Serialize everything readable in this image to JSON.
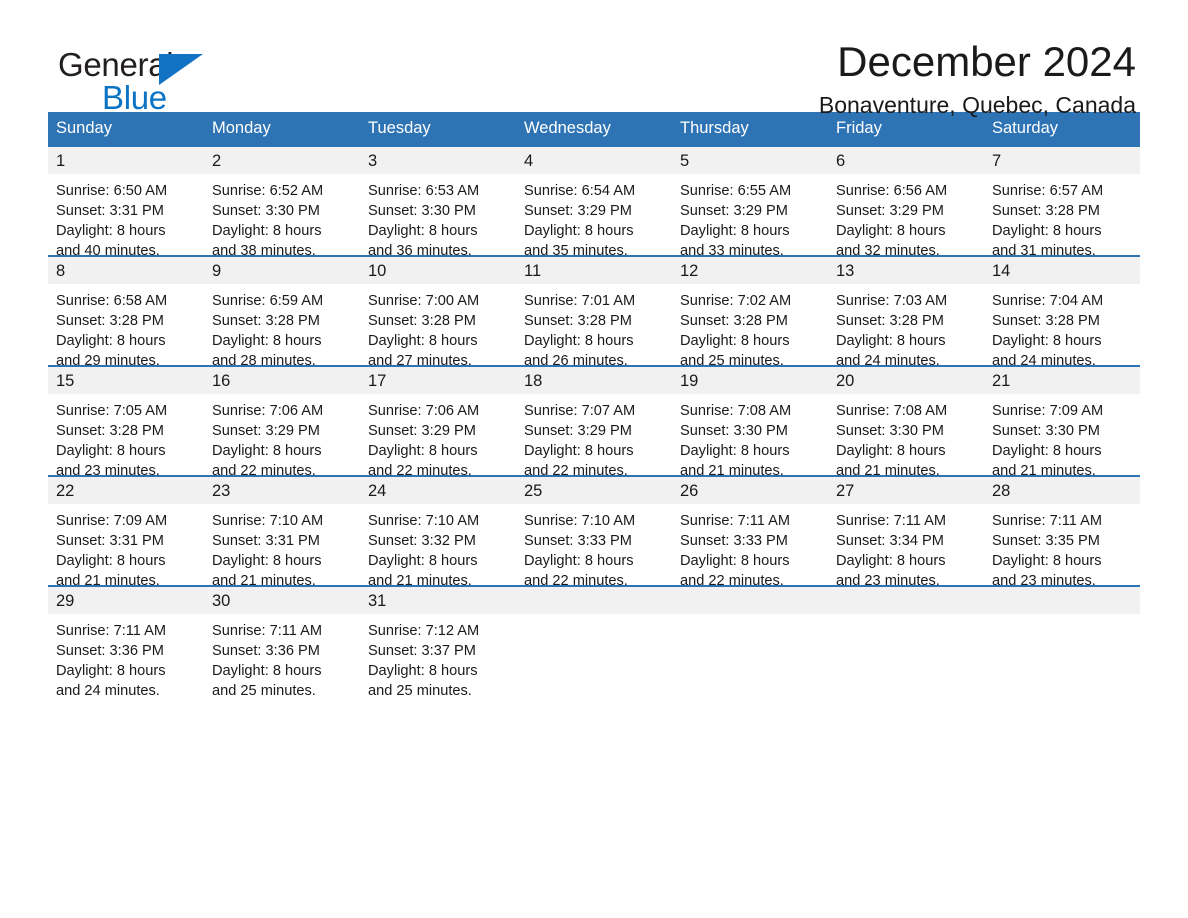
{
  "brand": {
    "name_part1": "General",
    "name_part2": "Blue",
    "accent_color": "#0b74c4",
    "header_color": "#2e74b5"
  },
  "header": {
    "month_title": "December 2024",
    "location": "Bonaventure, Quebec, Canada"
  },
  "weekday_headers": [
    "Sunday",
    "Monday",
    "Tuesday",
    "Wednesday",
    "Thursday",
    "Friday",
    "Saturday"
  ],
  "labels": {
    "sunrise_prefix": "Sunrise:",
    "sunset_prefix": "Sunset:",
    "daylight_prefix": "Daylight:"
  },
  "weeks": [
    [
      {
        "day": "1",
        "sunrise": "Sunrise: 6:50 AM",
        "sunset": "Sunset: 3:31 PM",
        "daylight_line1": "Daylight: 8 hours",
        "daylight_line2": "and 40 minutes."
      },
      {
        "day": "2",
        "sunrise": "Sunrise: 6:52 AM",
        "sunset": "Sunset: 3:30 PM",
        "daylight_line1": "Daylight: 8 hours",
        "daylight_line2": "and 38 minutes."
      },
      {
        "day": "3",
        "sunrise": "Sunrise: 6:53 AM",
        "sunset": "Sunset: 3:30 PM",
        "daylight_line1": "Daylight: 8 hours",
        "daylight_line2": "and 36 minutes."
      },
      {
        "day": "4",
        "sunrise": "Sunrise: 6:54 AM",
        "sunset": "Sunset: 3:29 PM",
        "daylight_line1": "Daylight: 8 hours",
        "daylight_line2": "and 35 minutes."
      },
      {
        "day": "5",
        "sunrise": "Sunrise: 6:55 AM",
        "sunset": "Sunset: 3:29 PM",
        "daylight_line1": "Daylight: 8 hours",
        "daylight_line2": "and 33 minutes."
      },
      {
        "day": "6",
        "sunrise": "Sunrise: 6:56 AM",
        "sunset": "Sunset: 3:29 PM",
        "daylight_line1": "Daylight: 8 hours",
        "daylight_line2": "and 32 minutes."
      },
      {
        "day": "7",
        "sunrise": "Sunrise: 6:57 AM",
        "sunset": "Sunset: 3:28 PM",
        "daylight_line1": "Daylight: 8 hours",
        "daylight_line2": "and 31 minutes."
      }
    ],
    [
      {
        "day": "8",
        "sunrise": "Sunrise: 6:58 AM",
        "sunset": "Sunset: 3:28 PM",
        "daylight_line1": "Daylight: 8 hours",
        "daylight_line2": "and 29 minutes."
      },
      {
        "day": "9",
        "sunrise": "Sunrise: 6:59 AM",
        "sunset": "Sunset: 3:28 PM",
        "daylight_line1": "Daylight: 8 hours",
        "daylight_line2": "and 28 minutes."
      },
      {
        "day": "10",
        "sunrise": "Sunrise: 7:00 AM",
        "sunset": "Sunset: 3:28 PM",
        "daylight_line1": "Daylight: 8 hours",
        "daylight_line2": "and 27 minutes."
      },
      {
        "day": "11",
        "sunrise": "Sunrise: 7:01 AM",
        "sunset": "Sunset: 3:28 PM",
        "daylight_line1": "Daylight: 8 hours",
        "daylight_line2": "and 26 minutes."
      },
      {
        "day": "12",
        "sunrise": "Sunrise: 7:02 AM",
        "sunset": "Sunset: 3:28 PM",
        "daylight_line1": "Daylight: 8 hours",
        "daylight_line2": "and 25 minutes."
      },
      {
        "day": "13",
        "sunrise": "Sunrise: 7:03 AM",
        "sunset": "Sunset: 3:28 PM",
        "daylight_line1": "Daylight: 8 hours",
        "daylight_line2": "and 24 minutes."
      },
      {
        "day": "14",
        "sunrise": "Sunrise: 7:04 AM",
        "sunset": "Sunset: 3:28 PM",
        "daylight_line1": "Daylight: 8 hours",
        "daylight_line2": "and 24 minutes."
      }
    ],
    [
      {
        "day": "15",
        "sunrise": "Sunrise: 7:05 AM",
        "sunset": "Sunset: 3:28 PM",
        "daylight_line1": "Daylight: 8 hours",
        "daylight_line2": "and 23 minutes."
      },
      {
        "day": "16",
        "sunrise": "Sunrise: 7:06 AM",
        "sunset": "Sunset: 3:29 PM",
        "daylight_line1": "Daylight: 8 hours",
        "daylight_line2": "and 22 minutes."
      },
      {
        "day": "17",
        "sunrise": "Sunrise: 7:06 AM",
        "sunset": "Sunset: 3:29 PM",
        "daylight_line1": "Daylight: 8 hours",
        "daylight_line2": "and 22 minutes."
      },
      {
        "day": "18",
        "sunrise": "Sunrise: 7:07 AM",
        "sunset": "Sunset: 3:29 PM",
        "daylight_line1": "Daylight: 8 hours",
        "daylight_line2": "and 22 minutes."
      },
      {
        "day": "19",
        "sunrise": "Sunrise: 7:08 AM",
        "sunset": "Sunset: 3:30 PM",
        "daylight_line1": "Daylight: 8 hours",
        "daylight_line2": "and 21 minutes."
      },
      {
        "day": "20",
        "sunrise": "Sunrise: 7:08 AM",
        "sunset": "Sunset: 3:30 PM",
        "daylight_line1": "Daylight: 8 hours",
        "daylight_line2": "and 21 minutes."
      },
      {
        "day": "21",
        "sunrise": "Sunrise: 7:09 AM",
        "sunset": "Sunset: 3:30 PM",
        "daylight_line1": "Daylight: 8 hours",
        "daylight_line2": "and 21 minutes."
      }
    ],
    [
      {
        "day": "22",
        "sunrise": "Sunrise: 7:09 AM",
        "sunset": "Sunset: 3:31 PM",
        "daylight_line1": "Daylight: 8 hours",
        "daylight_line2": "and 21 minutes."
      },
      {
        "day": "23",
        "sunrise": "Sunrise: 7:10 AM",
        "sunset": "Sunset: 3:31 PM",
        "daylight_line1": "Daylight: 8 hours",
        "daylight_line2": "and 21 minutes."
      },
      {
        "day": "24",
        "sunrise": "Sunrise: 7:10 AM",
        "sunset": "Sunset: 3:32 PM",
        "daylight_line1": "Daylight: 8 hours",
        "daylight_line2": "and 21 minutes."
      },
      {
        "day": "25",
        "sunrise": "Sunrise: 7:10 AM",
        "sunset": "Sunset: 3:33 PM",
        "daylight_line1": "Daylight: 8 hours",
        "daylight_line2": "and 22 minutes."
      },
      {
        "day": "26",
        "sunrise": "Sunrise: 7:11 AM",
        "sunset": "Sunset: 3:33 PM",
        "daylight_line1": "Daylight: 8 hours",
        "daylight_line2": "and 22 minutes."
      },
      {
        "day": "27",
        "sunrise": "Sunrise: 7:11 AM",
        "sunset": "Sunset: 3:34 PM",
        "daylight_line1": "Daylight: 8 hours",
        "daylight_line2": "and 23 minutes."
      },
      {
        "day": "28",
        "sunrise": "Sunrise: 7:11 AM",
        "sunset": "Sunset: 3:35 PM",
        "daylight_line1": "Daylight: 8 hours",
        "daylight_line2": "and 23 minutes."
      }
    ],
    [
      {
        "day": "29",
        "sunrise": "Sunrise: 7:11 AM",
        "sunset": "Sunset: 3:36 PM",
        "daylight_line1": "Daylight: 8 hours",
        "daylight_line2": "and 24 minutes."
      },
      {
        "day": "30",
        "sunrise": "Sunrise: 7:11 AM",
        "sunset": "Sunset: 3:36 PM",
        "daylight_line1": "Daylight: 8 hours",
        "daylight_line2": "and 25 minutes."
      },
      {
        "day": "31",
        "sunrise": "Sunrise: 7:12 AM",
        "sunset": "Sunset: 3:37 PM",
        "daylight_line1": "Daylight: 8 hours",
        "daylight_line2": "and 25 minutes."
      },
      {
        "day": "",
        "sunrise": "",
        "sunset": "",
        "daylight_line1": "",
        "daylight_line2": ""
      },
      {
        "day": "",
        "sunrise": "",
        "sunset": "",
        "daylight_line1": "",
        "daylight_line2": ""
      },
      {
        "day": "",
        "sunrise": "",
        "sunset": "",
        "daylight_line1": "",
        "daylight_line2": ""
      },
      {
        "day": "",
        "sunrise": "",
        "sunset": "",
        "daylight_line1": "",
        "daylight_line2": ""
      }
    ]
  ]
}
